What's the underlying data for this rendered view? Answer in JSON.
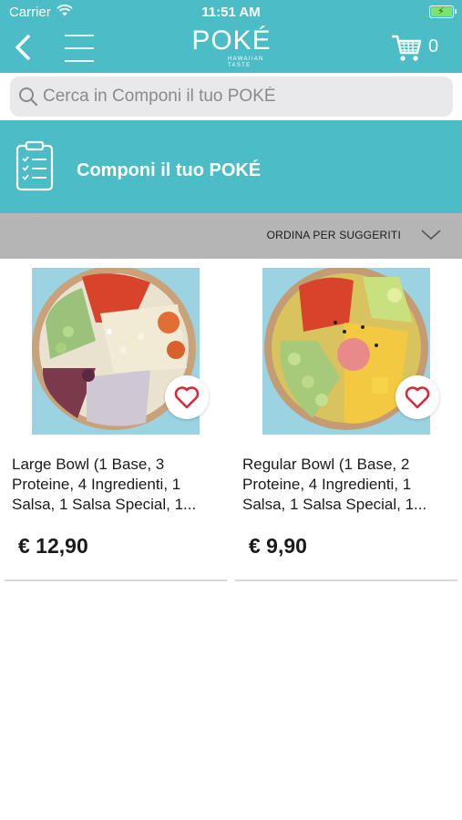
{
  "status_bar": {
    "carrier": "Carrier",
    "time": "11:51 AM",
    "battery_icon": "battery-charging-icon"
  },
  "header": {
    "back_icon": "chevron-left-icon",
    "menu_icon": "hamburger-menu-icon",
    "logo_text": "POKÉ",
    "logo_subtext": "HAWAIIAN TASTE",
    "cart_icon": "cart-icon",
    "cart_count": "0",
    "accent_color": "#4cbdc6"
  },
  "search": {
    "placeholder": "Cerca in Componi il tuo POKÉ",
    "value": ""
  },
  "category": {
    "icon": "clipboard-list-icon",
    "title": "Componi il tuo POKÉ"
  },
  "sort": {
    "label": "ORDINA PER SUGGERITI",
    "icon": "chevron-down-icon"
  },
  "products": [
    {
      "name": "Large Bowl (1 Base, 3 Proteine, 4 Ingredienti, 1 Salsa, 1 Salsa Special, 1...",
      "price": "€ 12,90",
      "favorite_icon": "heart-outline-icon"
    },
    {
      "name": "Regular Bowl (1 Base, 2 Proteine, 4 Ingredienti, 1 Salsa, 1 Salsa Special, 1...",
      "price": "€ 9,90",
      "favorite_icon": "heart-outline-icon"
    }
  ]
}
